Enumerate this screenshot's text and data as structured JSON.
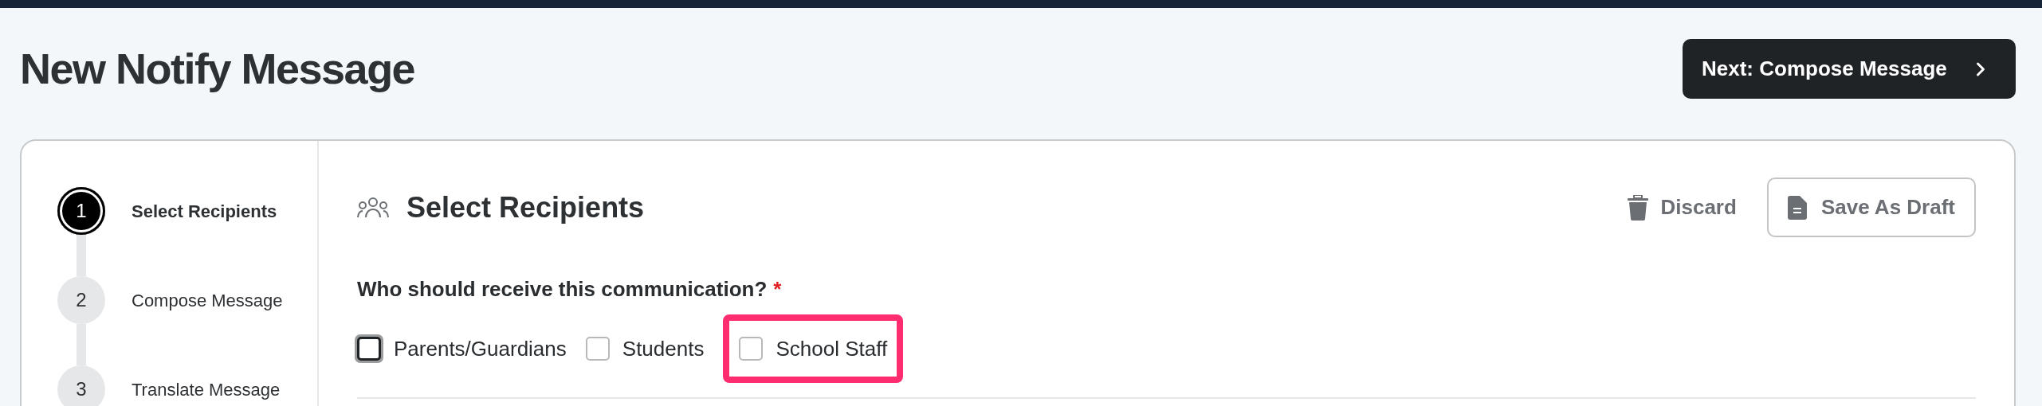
{
  "page_title": "New Notify Message",
  "next_button": {
    "label": "Next: Compose Message"
  },
  "steps": [
    {
      "number": "1",
      "label": "Select Recipients",
      "selected": true
    },
    {
      "number": "2",
      "label": "Compose Message",
      "selected": false
    },
    {
      "number": "3",
      "label": "Translate Message",
      "selected": false
    }
  ],
  "section": {
    "title": "Select Recipients",
    "discard": "Discard",
    "save_draft": "Save As Draft"
  },
  "question": {
    "label": "Who should receive this communication?",
    "required_mark": "*"
  },
  "options": [
    {
      "label": "Parents/Guardians",
      "checked": false,
      "focused": true,
      "highlighted": false
    },
    {
      "label": "Students",
      "checked": false,
      "focused": false,
      "highlighted": false
    },
    {
      "label": "School Staff",
      "checked": false,
      "focused": false,
      "highlighted": true
    }
  ]
}
